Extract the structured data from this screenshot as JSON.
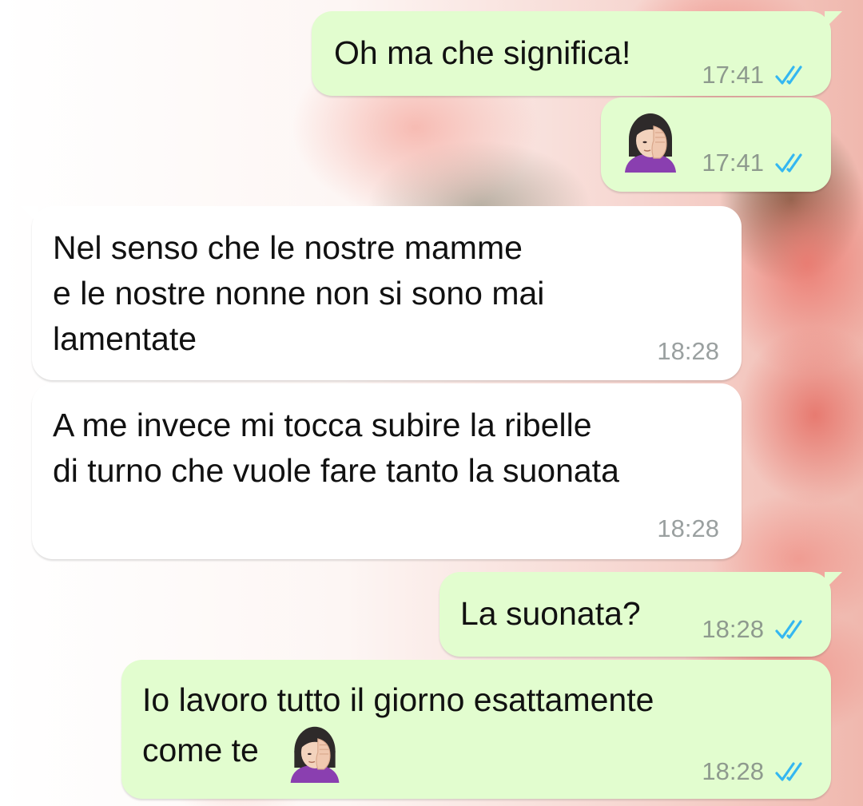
{
  "messages": [
    {
      "direction": "outgoing",
      "text": "Oh ma che significa!",
      "time": "17:41",
      "status": "read-double-check-icon"
    },
    {
      "direction": "outgoing",
      "text": "",
      "emoji": "woman-facepalming-emoji",
      "time": "17:41",
      "status": "read-double-check-icon"
    },
    {
      "direction": "incoming",
      "lines": [
        "Nel senso che le nostre mamme",
        "e le nostre nonne non si sono mai",
        "lamentate"
      ],
      "time": "18:28"
    },
    {
      "direction": "incoming",
      "lines": [
        "A me invece mi tocca subire la ribelle",
        "di turno che vuole fare tanto la suonata"
      ],
      "time": "18:28"
    },
    {
      "direction": "outgoing",
      "text": "La suonata?",
      "time": "18:28",
      "status": "read-double-check-icon"
    },
    {
      "direction": "outgoing",
      "lines": [
        "Io lavoro tutto il giorno esattamente",
        "come te"
      ],
      "emoji": "woman-facepalming-emoji",
      "time": "18:28",
      "status": "read-double-check-icon"
    }
  ],
  "colors": {
    "outgoing_bubble": "#e2fdcf",
    "incoming_bubble": "#ffffff",
    "read_ticks": "#34b7f1",
    "timestamp": "#8e9a8e"
  }
}
